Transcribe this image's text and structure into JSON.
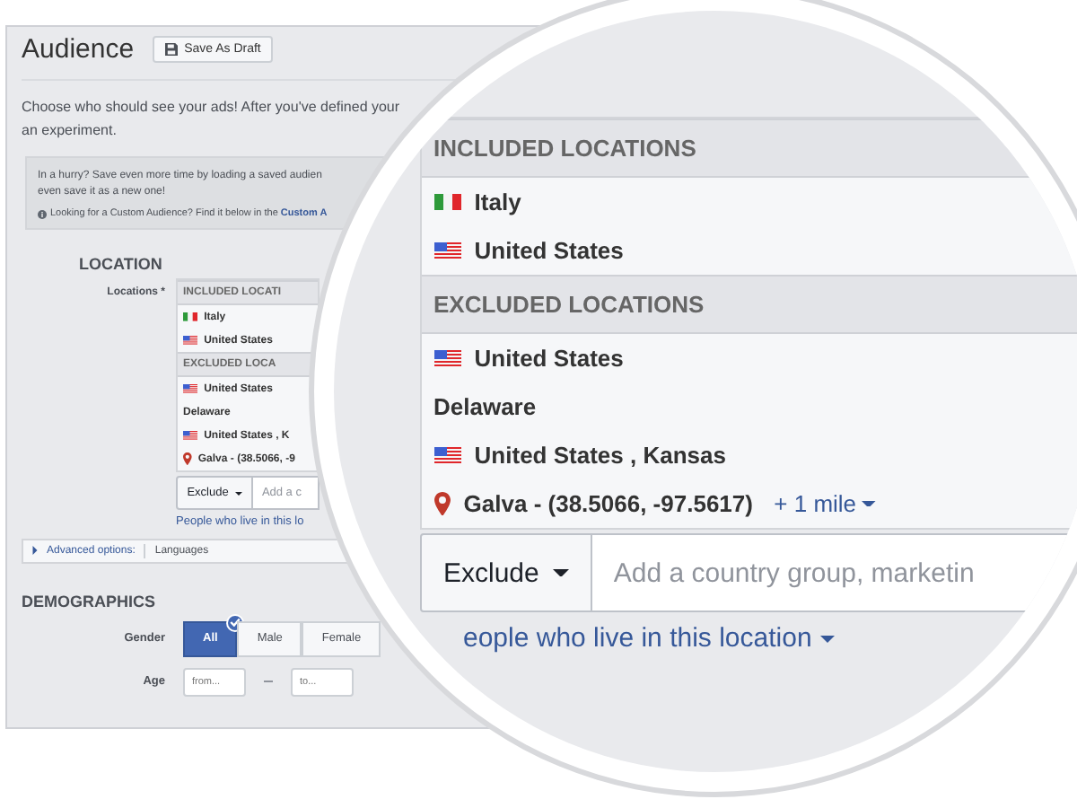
{
  "panel": {
    "title": "Audience",
    "save_button": "Save As Draft",
    "intro": [
      "Choose who should see your ads! After you've defined your",
      "an experiment."
    ],
    "hint": {
      "lines": [
        "In a hurry? Save even more time by loading a saved audien",
        "even save it as a new one!"
      ],
      "note": "Looking for a Custom Audience? Find it below in the ",
      "note_link": "Custom A"
    },
    "location": {
      "heading": "LOCATION",
      "label": "Locations *",
      "included": {
        "heading": "INCLUDED LOCATI",
        "items": [
          {
            "kind": "flag_it",
            "label": "Italy"
          },
          {
            "kind": "flag_us",
            "label": "United States"
          }
        ]
      },
      "excluded": {
        "heading": "EXCLUDED LOCA",
        "items": [
          {
            "kind": "flag_us",
            "label": "United States"
          },
          {
            "kind": "region",
            "label": "Delaware"
          },
          {
            "kind": "flag_us",
            "label": "United States , K"
          },
          {
            "kind": "pin",
            "label": "Galva - (38.5066, -9"
          }
        ]
      },
      "mode": "Exclude",
      "placeholder": "Add a c",
      "link": "People who live in this lo"
    },
    "advanced": {
      "label": "Advanced options:",
      "value": "Languages"
    },
    "demographics": {
      "heading": "DEMOGRAPHICS",
      "gender": {
        "label": "Gender",
        "options": [
          {
            "label": "All",
            "selected": true
          },
          {
            "label": "Male",
            "selected": false
          },
          {
            "label": "Female",
            "selected": false
          }
        ]
      },
      "age": {
        "label": "Age",
        "from": {
          "placeholder": "from..."
        },
        "to": {
          "placeholder": "to..."
        }
      }
    }
  },
  "magnifier": {
    "included": {
      "heading": "INCLUDED LOCATIONS",
      "items": [
        {
          "kind": "flag_it",
          "label": "Italy"
        },
        {
          "kind": "flag_us",
          "label": "United States"
        }
      ]
    },
    "excluded": {
      "heading": "EXCLUDED LOCATIONS",
      "items": [
        {
          "kind": "flag_us",
          "label": "United States"
        },
        {
          "kind": "region",
          "label": "Delaware"
        },
        {
          "kind": "flag_us",
          "label": "United States , Kansas"
        },
        {
          "kind": "pin",
          "label": "Galva - (38.5066, -97.5617)",
          "radius": "+ 1 mile"
        }
      ]
    },
    "mode": "Exclude",
    "placeholder": "Add a country group, marketin",
    "link": "eople who live in this location"
  }
}
